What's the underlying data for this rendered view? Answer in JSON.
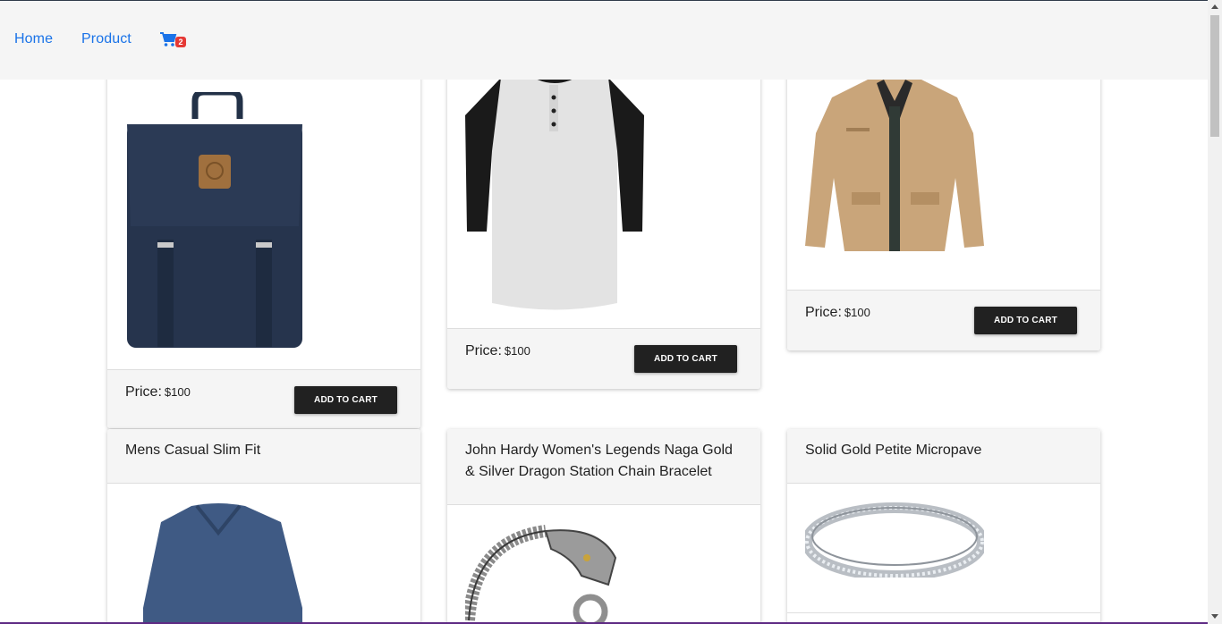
{
  "nav": {
    "home_label": "Home",
    "product_label": "Product",
    "cart_count": "2",
    "cart_icon": "cart-icon"
  },
  "colors": {
    "link": "#1a73e8",
    "button": "#212121",
    "badge": "#e53935",
    "panel": "#f5f5f5"
  },
  "products_top": [
    {
      "image": "backpack",
      "price_label": "Price:",
      "price": "$100",
      "button": "ADD TO CART"
    },
    {
      "image": "raglan-shirt",
      "price_label": "Price:",
      "price": "$100",
      "button": "ADD TO CART"
    },
    {
      "image": "jacket",
      "price_label": "Price:",
      "price": "$100",
      "button": "ADD TO CART"
    }
  ],
  "products_bottom": [
    {
      "title": "Mens Casual Slim Fit",
      "image": "v-neck-shirt"
    },
    {
      "title": "John Hardy Women's Legends Naga Gold & Silver Dragon Station Chain Bracelet",
      "image": "dragon-bracelet"
    },
    {
      "title": "Solid Gold Petite Micropave",
      "image": "ring"
    }
  ]
}
